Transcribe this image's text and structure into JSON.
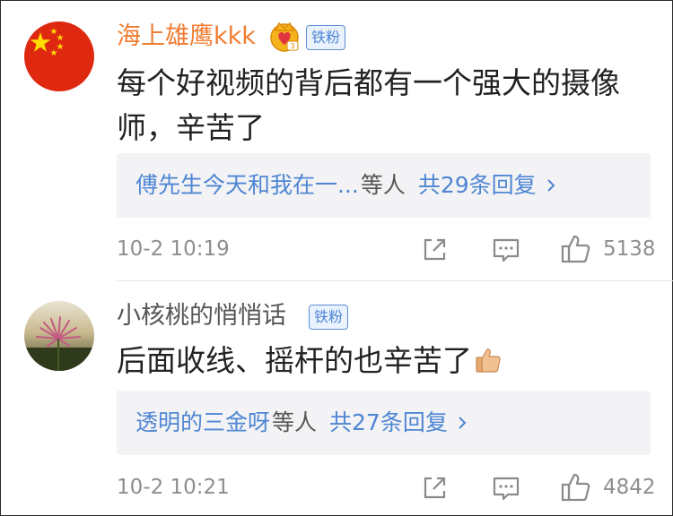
{
  "comments": [
    {
      "username": "海上雄鹰kkk",
      "username_color": "#f07c31",
      "avatar_icon": "china-flag-icon",
      "has_crown_badge": true,
      "fan_badge": "铁粉",
      "text": "每个好视频的背后都有一个强大的摄像师，辛苦了",
      "reply_preview": {
        "name": "傅先生今天和我在一...",
        "mid": "等人",
        "count_label": "共29条回复"
      },
      "timestamp": "10-2 10:19",
      "like_count": "5138"
    },
    {
      "username": "小核桃的悄悄话",
      "username_color": "#555555",
      "avatar_icon": "flower-photo-avatar",
      "has_crown_badge": false,
      "fan_badge": "铁粉",
      "text": "后面收线、摇杆的也辛苦了",
      "trailing_emoji": "thumbs-up-emoji",
      "reply_preview": {
        "name": "透明的三金呀",
        "mid": "等人",
        "count_label": "共27条回复"
      },
      "timestamp": "10-2 10:21",
      "like_count": "4842"
    }
  ],
  "colors": {
    "link_blue": "#4f86d3",
    "meta_gray": "#8e8e8e",
    "reply_bg": "#f3f3f5",
    "vip_orange": "#f07c31"
  }
}
